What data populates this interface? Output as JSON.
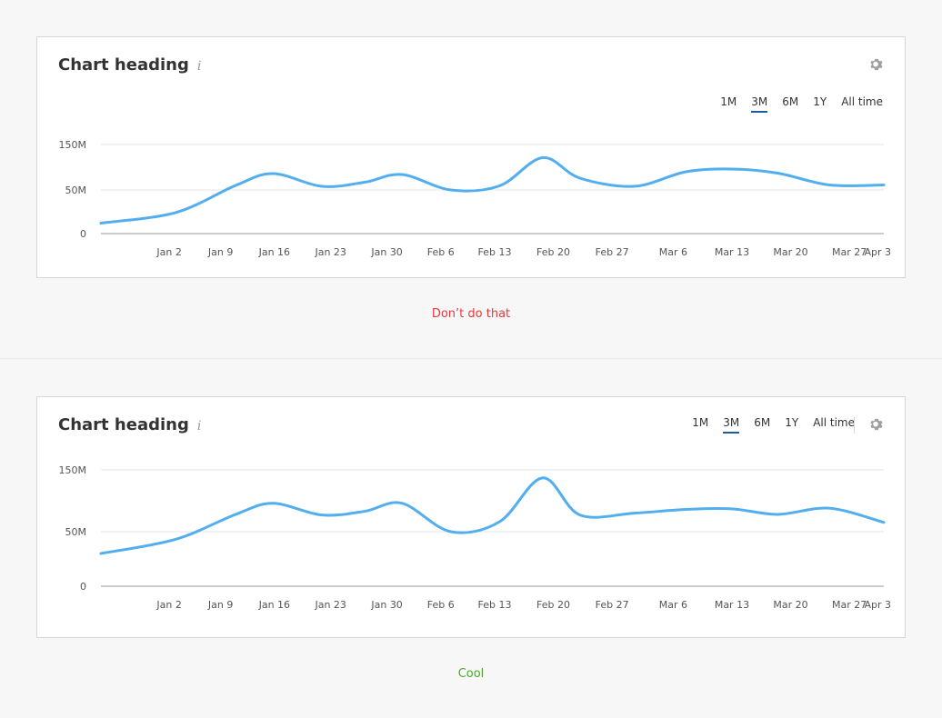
{
  "charts": [
    {
      "heading": "Chart heading",
      "info_icon": "i",
      "periods": [
        "1M",
        "3M",
        "6M",
        "1Y",
        "All time"
      ],
      "active_period": "3M",
      "caption": "Don’t do that",
      "caption_color": "#e23b3b"
    },
    {
      "heading": "Chart heading",
      "info_icon": "i",
      "periods": [
        "1M",
        "3M",
        "6M",
        "1Y",
        "All time"
      ],
      "active_period": "3M",
      "caption": "Cool",
      "caption_color": "#4ca827"
    }
  ],
  "icons": {
    "settings": "gear-icon",
    "info": "info-icon"
  },
  "colors": {
    "line": "#52aeef",
    "grid": "#e6e6e6",
    "axis": "#9a9a9a",
    "active_tab": "#1f5c9e"
  },
  "chart_data": [
    {
      "type": "line",
      "title": "Chart heading",
      "categories": [
        "Jan 2",
        "Jan 9",
        "Jan 16",
        "Jan 23",
        "Jan 30",
        "Feb 6",
        "Feb 13",
        "Feb 20",
        "Feb 27",
        "Mar 6",
        "Mar 13",
        "Mar 20",
        "Mar 27",
        "Apr 3"
      ],
      "y_ticks": [
        "0",
        "50M",
        "150M"
      ],
      "ylim": [
        0,
        150
      ],
      "x_points": [
        0,
        1.3,
        2.35,
        3.0,
        3.85,
        4.6,
        5.25,
        6.1,
        6.95,
        7.7,
        8.35,
        9.3,
        10.2,
        11.0,
        11.8,
        12.7,
        13.65
      ],
      "y_values": [
        12,
        24,
        60,
        86,
        86,
        67,
        55,
        67,
        84,
        84,
        50,
        59,
        121,
        76,
        58,
        101,
        98,
        61
      ],
      "series": [
        {
          "x": [
            0,
            1.3,
            2.35,
            3.0,
            3.85,
            4.6,
            5.25,
            6.1,
            6.95,
            7.7,
            8.35,
            9.3,
            10.2,
            11.0,
            11.8,
            12.7,
            13.65
          ],
          "y": [
            12,
            24,
            60,
            86,
            58,
            67,
            84,
            50,
            59,
            121,
            76,
            58,
            90,
            96,
            87,
            61,
            61
          ]
        }
      ],
      "grid": true
    },
    {
      "type": "line",
      "title": "Chart heading",
      "categories": [
        "Jan 2",
        "Jan 9",
        "Jan 16",
        "Jan 23",
        "Jan 30",
        "Feb 6",
        "Feb 13",
        "Feb 20",
        "Feb 27",
        "Mar 6",
        "Mar 13",
        "Mar 20",
        "Mar 27",
        "Apr 3"
      ],
      "y_ticks": [
        "0",
        "50M",
        "150M"
      ],
      "ylim": [
        0,
        150
      ],
      "series": [
        {
          "x": [
            0,
            1.3,
            2.35,
            3.0,
            3.85,
            4.6,
            5.25,
            6.1,
            6.95,
            7.7,
            8.35,
            9.3,
            10.2,
            11.0,
            11.8,
            12.7,
            13.65
          ],
          "y": [
            30,
            43,
            78,
            96,
            77,
            83,
            96,
            50,
            66,
            137,
            77,
            80,
            86,
            87,
            78,
            88,
            65
          ]
        }
      ],
      "grid": true
    }
  ]
}
